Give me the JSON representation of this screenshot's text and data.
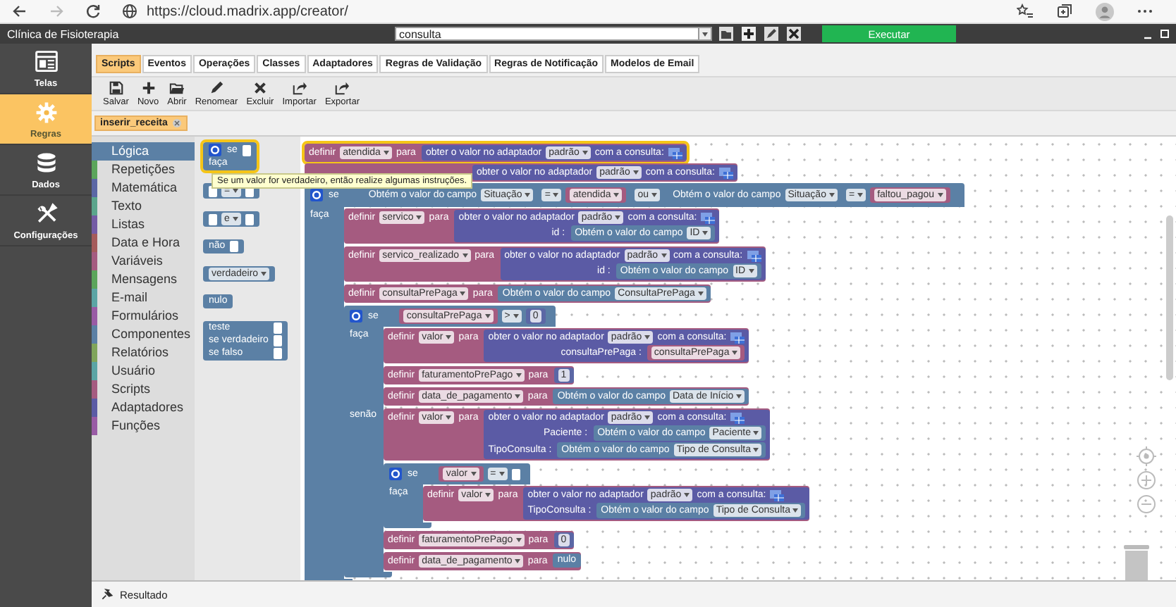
{
  "browser": {
    "url": "https://cloud.madrix.app/creator/"
  },
  "app": {
    "title": "Clínica de Fisioterapia",
    "script_select": "consulta",
    "run_button": "Executar"
  },
  "sidebar": [
    {
      "label": "Telas",
      "selected": false
    },
    {
      "label": "Regras",
      "selected": true
    },
    {
      "label": "Dados",
      "selected": false
    },
    {
      "label": "Configurações",
      "selected": false
    }
  ],
  "tabs": [
    {
      "label": "Scripts",
      "selected": true
    },
    {
      "label": "Eventos",
      "selected": false
    },
    {
      "label": "Operações",
      "selected": false
    },
    {
      "label": "Classes",
      "selected": false
    },
    {
      "label": "Adaptadores",
      "selected": false
    },
    {
      "label": "Regras de Validação",
      "selected": false
    },
    {
      "label": "Regras de Notificação",
      "selected": false
    },
    {
      "label": "Modelos de Email",
      "selected": false
    }
  ],
  "toolbar": [
    "Salvar",
    "Novo",
    "Abrir",
    "Renomear",
    "Excluir",
    "Importar",
    "Exportar"
  ],
  "open_script": {
    "name": "inserir_receita"
  },
  "toolbox": [
    {
      "label": "Lógica",
      "color": "#5b80a5",
      "selected": true
    },
    {
      "label": "Repetições",
      "color": "#5ba55b",
      "selected": false
    },
    {
      "label": "Matemática",
      "color": "#5b67a5",
      "selected": false
    },
    {
      "label": "Texto",
      "color": "#5ba58c",
      "selected": false
    },
    {
      "label": "Listas",
      "color": "#745ba5",
      "selected": false
    },
    {
      "label": "Data e Hora",
      "color": "#a55b5b",
      "selected": false
    },
    {
      "label": "Variáveis",
      "color": "#a55b80",
      "selected": false
    },
    {
      "label": "Mensagens",
      "color": "#5ba55b",
      "selected": false
    },
    {
      "label": "E-mail",
      "color": "#5ba5a5",
      "selected": false
    },
    {
      "label": "Formulários",
      "color": "#995ba5",
      "selected": false
    },
    {
      "label": "Componentes",
      "color": "#5b80a5",
      "selected": false
    },
    {
      "label": "Relatórios",
      "color": "#80a55b",
      "selected": false
    },
    {
      "label": "Usuário",
      "color": "#5ba5a5",
      "selected": false
    },
    {
      "label": "Scripts",
      "color": "#a55b80",
      "selected": false
    },
    {
      "label": "Adaptadores",
      "color": "#5b5ba5",
      "selected": false
    },
    {
      "label": "Funções",
      "color": "#995ba5",
      "selected": false
    }
  ],
  "flyout": [
    {
      "kind": "if",
      "words": [
        "se",
        "faça"
      ],
      "highlighted": true
    },
    {
      "kind": "compare",
      "op": "="
    },
    {
      "kind": "compare",
      "op": "e"
    },
    {
      "kind": "not",
      "label": "não"
    },
    {
      "kind": "dropdown",
      "label": "verdadeiro"
    },
    {
      "kind": "plain",
      "label": "nulo"
    },
    {
      "kind": "ternary",
      "lines": [
        "teste",
        "se verdadeiro",
        "se falso"
      ]
    }
  ],
  "tooltip": "Se um valor for verdadeiro, então realize algumas instruções.",
  "workspace": [
    {
      "kind": "set",
      "selected": true,
      "keyword": "definir",
      "var": "atendida",
      "to": "para",
      "value": {
        "kind": "adapter",
        "text": "obter o valor no adaptador",
        "adapter": "padrão",
        "suffix": "com a consulta:"
      }
    },
    {
      "kind": "set",
      "selected": false,
      "value": {
        "kind": "adapter",
        "text": "obter o valor no adaptador",
        "adapter": "padrão",
        "suffix": "com a consulta:"
      }
    },
    {
      "kind": "if",
      "selected": false,
      "keyword": "se",
      "condition": {
        "kind": "or",
        "op": "ou",
        "left": {
          "kind": "compare",
          "op": "=",
          "left": {
            "kind": "field",
            "text": "Obtém o valor do campo",
            "field": "Situação"
          },
          "right": {
            "kind": "var",
            "name": "atendida"
          }
        },
        "right": {
          "kind": "compare",
          "op": "=",
          "left": {
            "kind": "field",
            "text": "Obtém o valor do campo",
            "field": "Situação"
          },
          "right": {
            "kind": "var",
            "name": "faltou_pagou"
          }
        }
      },
      "branches": [
        {
          "label": "faça",
          "body": [
            {
              "kind": "set",
              "keyword": "definir",
              "var": "servico",
              "to": "para",
              "value": {
                "kind": "adapter",
                "text": "obter o valor no adaptador",
                "adapter": "padrão",
                "suffix": "com a consulta:",
                "params": [
                  {
                    "label": "id :",
                    "value": {
                      "kind": "field",
                      "text": "Obtém o valor do campo",
                      "field": "ID"
                    }
                  }
                ]
              }
            },
            {
              "kind": "set",
              "keyword": "definir",
              "var": "servico_realizado",
              "to": "para",
              "value": {
                "kind": "adapter",
                "text": "obter o valor no adaptador",
                "adapter": "padrão",
                "suffix": "com a consulta:",
                "params": [
                  {
                    "label": "id :",
                    "value": {
                      "kind": "field",
                      "text": "Obtém o valor do campo",
                      "field": "ID"
                    }
                  }
                ]
              }
            },
            {
              "kind": "set",
              "keyword": "definir",
              "var": "consultaPrePaga",
              "to": "para",
              "value": {
                "kind": "field",
                "text": "Obtém o valor do campo",
                "field": "ConsultaPrePaga"
              }
            },
            {
              "kind": "if",
              "keyword": "se",
              "condition": {
                "kind": "compare",
                "op": ">",
                "left": {
                  "kind": "var",
                  "name": "consultaPrePaga"
                },
                "right": {
                  "kind": "number",
                  "value": "0"
                }
              },
              "branches": [
                {
                  "label": "faça",
                  "body": [
                    {
                      "kind": "set",
                      "keyword": "definir",
                      "var": "valor",
                      "to": "para",
                      "value": {
                        "kind": "adapter",
                        "text": "obter o valor no adaptador",
                        "adapter": "padrão",
                        "suffix": "com a consulta:",
                        "params": [
                          {
                            "label": "consultaPrePaga :",
                            "value": {
                              "kind": "var",
                              "name": "consultaPrePaga"
                            }
                          }
                        ]
                      }
                    },
                    {
                      "kind": "set",
                      "keyword": "definir",
                      "var": "faturamentoPrePago",
                      "to": "para",
                      "value": {
                        "kind": "number",
                        "value": "1"
                      }
                    },
                    {
                      "kind": "set",
                      "keyword": "definir",
                      "var": "data_de_pagamento",
                      "to": "para",
                      "value": {
                        "kind": "field",
                        "text": "Obtém o valor do campo",
                        "field": "Data de Início"
                      }
                    }
                  ]
                },
                {
                  "label": "senão",
                  "body": [
                    {
                      "kind": "set",
                      "keyword": "definir",
                      "var": "valor",
                      "to": "para",
                      "value": {
                        "kind": "adapter",
                        "text": "obter o valor no adaptador",
                        "adapter": "padrão",
                        "suffix": "com a consulta:",
                        "params": [
                          {
                            "label": "Paciente :",
                            "value": {
                              "kind": "field",
                              "text": "Obtém o valor do campo",
                              "field": "Paciente"
                            }
                          },
                          {
                            "label": "TipoConsulta :",
                            "value": {
                              "kind": "field",
                              "text": "Obtém o valor do campo",
                              "field": "Tipo de Consulta"
                            }
                          }
                        ]
                      }
                    },
                    {
                      "kind": "if",
                      "keyword": "se",
                      "condition": {
                        "kind": "compare",
                        "op": "=",
                        "left": {
                          "kind": "var",
                          "name": "valor"
                        }
                      },
                      "branches": [
                        {
                          "label": "faça",
                          "body": [
                            {
                              "kind": "set",
                              "keyword": "definir",
                              "var": "valor",
                              "to": "para",
                              "value": {
                                "kind": "adapter",
                                "text": "obter o valor no adaptador",
                                "adapter": "padrão",
                                "suffix": "com a consulta:",
                                "params": [
                                  {
                                    "label": "TipoConsulta :",
                                    "value": {
                                      "kind": "field",
                                      "text": "Obtém o valor do campo",
                                      "field": "Tipo de Consulta"
                                    }
                                  }
                                ]
                              }
                            }
                          ]
                        }
                      ]
                    },
                    {
                      "kind": "set",
                      "keyword": "definir",
                      "var": "faturamentoPrePago",
                      "to": "para",
                      "value": {
                        "kind": "number",
                        "value": "0"
                      }
                    },
                    {
                      "kind": "set",
                      "keyword": "definir",
                      "var": "data_de_pagamento",
                      "to": "para",
                      "value": {
                        "kind": "null",
                        "label": "nulo"
                      }
                    }
                  ]
                }
              ]
            }
          ]
        }
      ]
    }
  ],
  "result_panel": {
    "label": "Resultado"
  }
}
